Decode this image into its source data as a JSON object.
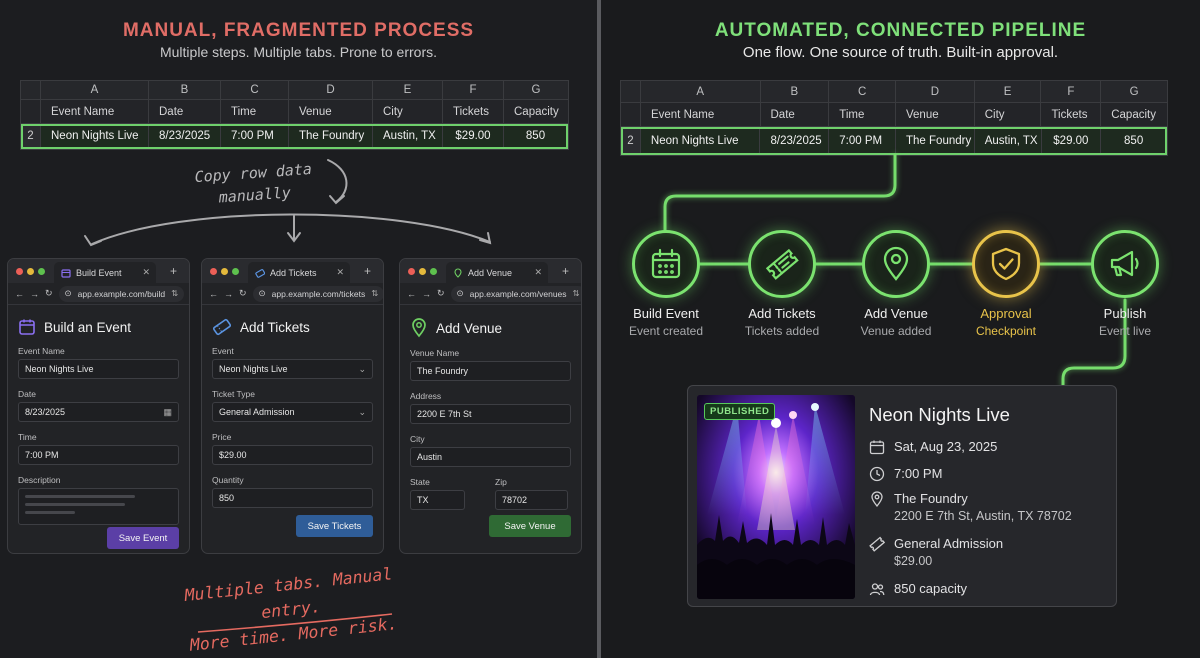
{
  "left": {
    "title": "MANUAL, FRAGMENTED PROCESS",
    "subtitle": "Multiple steps. Multiple tabs. Prone to errors.",
    "copy_note": "Copy row data\nmanually",
    "footer_note": "Multiple tabs. Manual entry.\nMore time. More risk."
  },
  "right": {
    "title": "AUTOMATED, CONNECTED PIPELINE",
    "subtitle": "One flow. One source of truth. Built-in approval."
  },
  "sheet": {
    "columns": [
      "A",
      "B",
      "C",
      "D",
      "E",
      "F",
      "G"
    ],
    "headers": [
      "Event Name",
      "Date",
      "Time",
      "Venue",
      "City",
      "Tickets",
      "Capacity"
    ],
    "row_number": "2",
    "row": [
      "Neon Nights Live",
      "8/23/2025",
      "7:00 PM",
      "The Foundry",
      "Austin, TX",
      "$29.00",
      "850"
    ]
  },
  "windows": {
    "event": {
      "tab": "Build Event",
      "url": "app.example.com/build",
      "title": "Build an Event",
      "name_label": "Event Name",
      "name_value": "Neon Nights Live",
      "date_label": "Date",
      "date_value": "8/23/2025",
      "time_label": "Time",
      "time_value": "7:00 PM",
      "desc_label": "Description",
      "button": "Save Event"
    },
    "tickets": {
      "tab": "Add Tickets",
      "url": "app.example.com/tickets",
      "title": "Add Tickets",
      "event_label": "Event",
      "event_value": "Neon Nights Live",
      "type_label": "Ticket Type",
      "type_value": "General Admission",
      "price_label": "Price",
      "price_value": "$29.00",
      "qty_label": "Quantity",
      "qty_value": "850",
      "button": "Save Tickets"
    },
    "venue": {
      "tab": "Add Venue",
      "url": "app.example.com/venues",
      "title": "Add Venue",
      "name_label": "Venue Name",
      "name_value": "The Foundry",
      "address_label": "Address",
      "address_value": "2200 E 7th St",
      "city_label": "City",
      "city_value": "Austin",
      "state_label": "State",
      "state_value": "TX",
      "zip_label": "Zip",
      "zip_value": "78702",
      "button": "Save Venue"
    }
  },
  "pipeline": [
    {
      "label": "Build Event",
      "sub": "Event created",
      "icon": "calendar-icon"
    },
    {
      "label": "Add Tickets",
      "sub": "Tickets added",
      "icon": "ticket-icon"
    },
    {
      "label": "Add Venue",
      "sub": "Venue added",
      "icon": "location-pin-icon"
    },
    {
      "label": "Approval",
      "sub": "Checkpoint",
      "icon": "shield-check-icon"
    },
    {
      "label": "Publish",
      "sub": "Event live",
      "icon": "megaphone-icon"
    }
  ],
  "card": {
    "badge": "PUBLISHED",
    "title": "Neon Nights Live",
    "date": "Sat, Aug 23, 2025",
    "time": "7:00 PM",
    "venue": "The Foundry",
    "address": "2200 E 7th St, Austin, TX 78702",
    "ticket_type": "General Admission",
    "price": "$29.00",
    "capacity": "850 capacity"
  },
  "colors": {
    "manual_red": "#e06d66",
    "pipeline_green": "#7be26f",
    "approval_gold": "#e8c34a",
    "event_purple": "#5b3fa6",
    "tickets_blue": "#2f5d98",
    "venue_green": "#2f6a34"
  }
}
